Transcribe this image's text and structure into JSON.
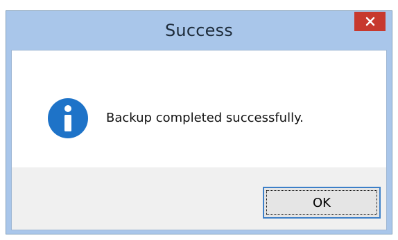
{
  "window": {
    "title": "Success",
    "close_icon": "close-icon"
  },
  "content": {
    "icon": "info-icon",
    "message": "Backup completed successfully."
  },
  "buttons": {
    "ok_label": "OK"
  },
  "colors": {
    "frame": "#a9c6ea",
    "close_button": "#c7392e",
    "info_icon": "#1e73c8",
    "footer": "#f0f0f0",
    "ok_border": "#3c7fc8"
  }
}
